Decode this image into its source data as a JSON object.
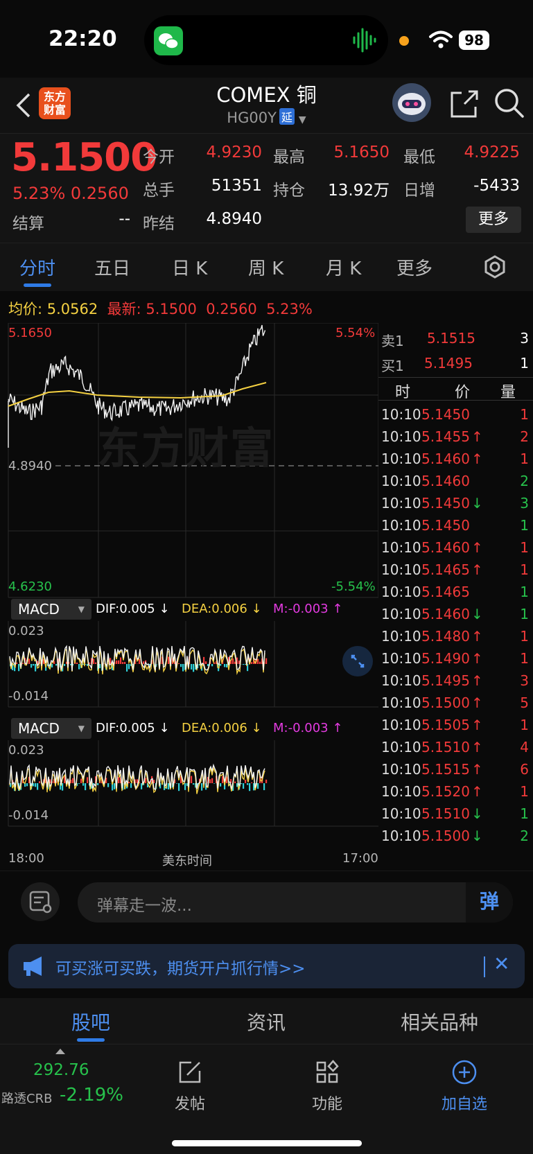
{
  "status": {
    "time": "22:20",
    "battery": "98"
  },
  "header": {
    "title": "COMEX 铜",
    "code": "HG00Y",
    "badge": "延",
    "logo": "东方财富"
  },
  "quote": {
    "price": "5.1500",
    "change_pct": "5.23%",
    "change": "0.2560",
    "fields": [
      {
        "label": "今开",
        "value": "4.9230",
        "color": "red"
      },
      {
        "label": "最高",
        "value": "5.1650",
        "color": "red"
      },
      {
        "label": "最低",
        "value": "4.9225",
        "color": "red"
      },
      {
        "label": "总手",
        "value": "51351",
        "color": "white"
      },
      {
        "label": "持仓",
        "value": "13.92万",
        "color": "white"
      },
      {
        "label": "日增",
        "value": "-5433",
        "color": "white"
      },
      {
        "label": "结算",
        "value": "--",
        "color": "white"
      },
      {
        "label": "昨结",
        "value": "4.8940",
        "color": "white"
      }
    ],
    "more": "更多"
  },
  "tabs": [
    "分时",
    "五日",
    "日 K",
    "周 K",
    "月 K",
    "更多"
  ],
  "avg": {
    "avg_label": "均价:",
    "avg_value": "5.0562",
    "last_label": "最新:",
    "last_value": "5.1500",
    "last_change": "0.2560",
    "last_pct": "5.23%"
  },
  "chart": {
    "high": "5.1650",
    "high_pct": "5.54%",
    "prev": "4.8940",
    "low": "4.6230",
    "low_pct": "-5.54%",
    "watermark": "东方财富",
    "macd1": {
      "name": "MACD",
      "dif": "DIF:0.005 ↓",
      "dea": "DEA:0.006 ↓",
      "m": "M:-0.003 ↑",
      "top": "0.023",
      "bottom": "-0.014"
    },
    "macd2": {
      "name": "MACD",
      "dif": "DIF:0.005 ↓",
      "dea": "DEA:0.006 ↓",
      "m": "M:-0.003 ↑",
      "top": "0.023",
      "bottom": "-0.014"
    },
    "x_start": "18:00",
    "x_mid": "美东时间",
    "x_end": "17:00"
  },
  "chart_data": {
    "type": "line",
    "x": [
      "18:00",
      "17:00"
    ],
    "ylim": [
      4.623,
      5.165
    ],
    "prev_settle": 4.894,
    "series": []
  },
  "book": {
    "sell": {
      "label": "卖1",
      "price": "5.1515",
      "qty": "3"
    },
    "buy": {
      "label": "买1",
      "price": "5.1495",
      "qty": "1"
    },
    "head": {
      "t": "时",
      "p": "价",
      "q": "量"
    },
    "ticks": [
      {
        "t": "10:10",
        "p": "5.1450",
        "dir": "",
        "q": "1",
        "qc": "red"
      },
      {
        "t": "10:10",
        "p": "5.1455",
        "dir": "↑",
        "q": "2",
        "qc": "red"
      },
      {
        "t": "10:10",
        "p": "5.1460",
        "dir": "↑",
        "q": "1",
        "qc": "red"
      },
      {
        "t": "10:10",
        "p": "5.1460",
        "dir": "",
        "q": "2",
        "qc": "green"
      },
      {
        "t": "10:10",
        "p": "5.1450",
        "dir": "↓",
        "q": "3",
        "qc": "green"
      },
      {
        "t": "10:10",
        "p": "5.1450",
        "dir": "",
        "q": "1",
        "qc": "green"
      },
      {
        "t": "10:10",
        "p": "5.1460",
        "dir": "↑",
        "q": "1",
        "qc": "red"
      },
      {
        "t": "10:10",
        "p": "5.1465",
        "dir": "↑",
        "q": "1",
        "qc": "red"
      },
      {
        "t": "10:10",
        "p": "5.1465",
        "dir": "",
        "q": "1",
        "qc": "green"
      },
      {
        "t": "10:10",
        "p": "5.1460",
        "dir": "↓",
        "q": "1",
        "qc": "green"
      },
      {
        "t": "10:10",
        "p": "5.1480",
        "dir": "↑",
        "q": "1",
        "qc": "red"
      },
      {
        "t": "10:10",
        "p": "5.1490",
        "dir": "↑",
        "q": "1",
        "qc": "red"
      },
      {
        "t": "10:10",
        "p": "5.1495",
        "dir": "↑",
        "q": "3",
        "qc": "red"
      },
      {
        "t": "10:10",
        "p": "5.1500",
        "dir": "↑",
        "q": "5",
        "qc": "red"
      },
      {
        "t": "10:10",
        "p": "5.1505",
        "dir": "↑",
        "q": "1",
        "qc": "red"
      },
      {
        "t": "10:10",
        "p": "5.1510",
        "dir": "↑",
        "q": "4",
        "qc": "red"
      },
      {
        "t": "10:10",
        "p": "5.1515",
        "dir": "↑",
        "q": "6",
        "qc": "red"
      },
      {
        "t": "10:10",
        "p": "5.1520",
        "dir": "↑",
        "q": "1",
        "qc": "red"
      },
      {
        "t": "10:10",
        "p": "5.1510",
        "dir": "↓",
        "q": "1",
        "qc": "green"
      },
      {
        "t": "10:10",
        "p": "5.1500",
        "dir": "↓",
        "q": "2",
        "qc": "green"
      }
    ]
  },
  "comment": {
    "placeholder": "弹幕走一波...",
    "danmu": "弹"
  },
  "promo": {
    "text": "可买涨可买跌，期货开户抓行情>>"
  },
  "sections": [
    "股吧",
    "资讯",
    "相关品种"
  ],
  "bottom": {
    "crb_value": "292.76",
    "crb_name": "路透CRB",
    "crb_pct": "-2.19%",
    "nav": [
      "发帖",
      "功能",
      "加自选"
    ]
  },
  "colors": {
    "up": "#f23a3a",
    "down": "#27c24c",
    "accent": "#2f7be6",
    "avg": "#f5d142"
  }
}
